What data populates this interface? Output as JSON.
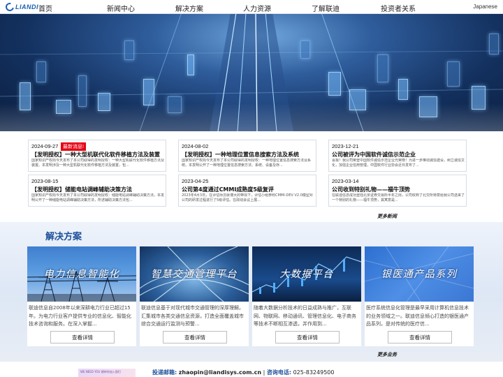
{
  "nav": {
    "logo_text": "LIANDI",
    "items": [
      "首页",
      "新闻中心",
      "解决方案",
      "人力资源",
      "了解联迪",
      "投资者关系"
    ],
    "lang": "Japanese"
  },
  "news": {
    "items": [
      {
        "date": "2024-09-27",
        "badge": "最新消息!",
        "title": "【发明授权】一种大型机联代化软件移植方法及装置",
        "excerpt": "国家知识产权局今天发布了本公司取得的发明授权：一种大型机联代化软件移植方法及装置。本发明涉及一种大型机联代化软件移植方法及装置，包..."
      },
      {
        "date": "2024-08-02",
        "badge": "",
        "title": "【发明授权】一种地理位置信息搜索方法及系统",
        "excerpt": "国家知识产权局今天发布了本公司取得的发明授权：一种地理位置信息搜索方法及系统。本发明公开了一种地理位置信息搜索方法、系统、设备及存..."
      },
      {
        "date": "2023-12-21",
        "badge": "",
        "title": "公司被评为中国软件诚信示范企业",
        "excerpt": "喜报！我公司荣登中国软件诚信示范企业光荣榜！为进一步推动诚信建设，树立诚信文化，加强企业信用管理，中国软件行业协会近日发布了..."
      },
      {
        "date": "2023-08-15",
        "badge": "",
        "title": "【发明授权】储能电站调峰辅助决策方法",
        "excerpt": "国家知识产权局今天发布了本公司取得的发明授权：储能电站调峰辅助决策方法。本发明公开了一种储能电站调峰辅助决策方法，所述辅助决策方法包..."
      },
      {
        "date": "2023-04-25",
        "badge": "",
        "title": "公司第4度通过CMMI成熟度5级复评",
        "excerpt": "2023年4月3日，在评估师员就博大的带领下，评估小组参照CMMI-DEV V2.0模型对公司的研发过程进行了5级评估。在政动会议上展..."
      },
      {
        "date": "2023-03-14",
        "badge": "",
        "title": "公司收到特别礼物——福牛顶势",
        "excerpt": "在联迪信息成功登陆北京证券交易所半年之际，公司收到了北交所特意给我公司送来了一个特别的礼物——福牛顶势，其寓意是..."
      }
    ],
    "more": "更多新闻"
  },
  "solutions": {
    "heading": "解决方案",
    "cards": [
      {
        "image_title": "电力信息智能化",
        "desc": "联迪信息自2008年以来深耕电力行业已超过15年。为电力行业客户提供专业的信息化、智能化技术咨询和服务。在深入掌握...",
        "button": "查看详情"
      },
      {
        "image_title": "智慧交通管理平台",
        "desc": "联迪信息基于对现代城市交通管理的深厚理解。汇集城市各类交通信息资源，打造全面覆盖城市综合交通运行监测与预警...",
        "button": "查看详情"
      },
      {
        "image_title": "大数据平台",
        "desc": "随着大数据分析技术的日益成熟与推广，互联网、物联网、移动通讯、管理信息化、电子商务等技术不断相互渗透，并作用到...",
        "button": "查看详情"
      },
      {
        "image_title": "银医通产品系列",
        "desc": "医疗系统信息化管理是最早采用计算机信息技术的业务领域之一。联迪信息倾心打造的银医通产品系列，是对传统的医疗信...",
        "button": "查看详情"
      }
    ],
    "more": "更多业务"
  },
  "footer": {
    "banner": "WE NEED YOU  期待你加入我们",
    "email_label": "投递邮箱:",
    "email": "zhaopin@liandisys.com.cn",
    "sep": "|",
    "phone_label": "咨询电话:",
    "phone": "025-83249500"
  },
  "colors": {
    "accent": "#1d4f9a",
    "badge": "#e60012",
    "hero_dark": "#0b1d3c"
  }
}
